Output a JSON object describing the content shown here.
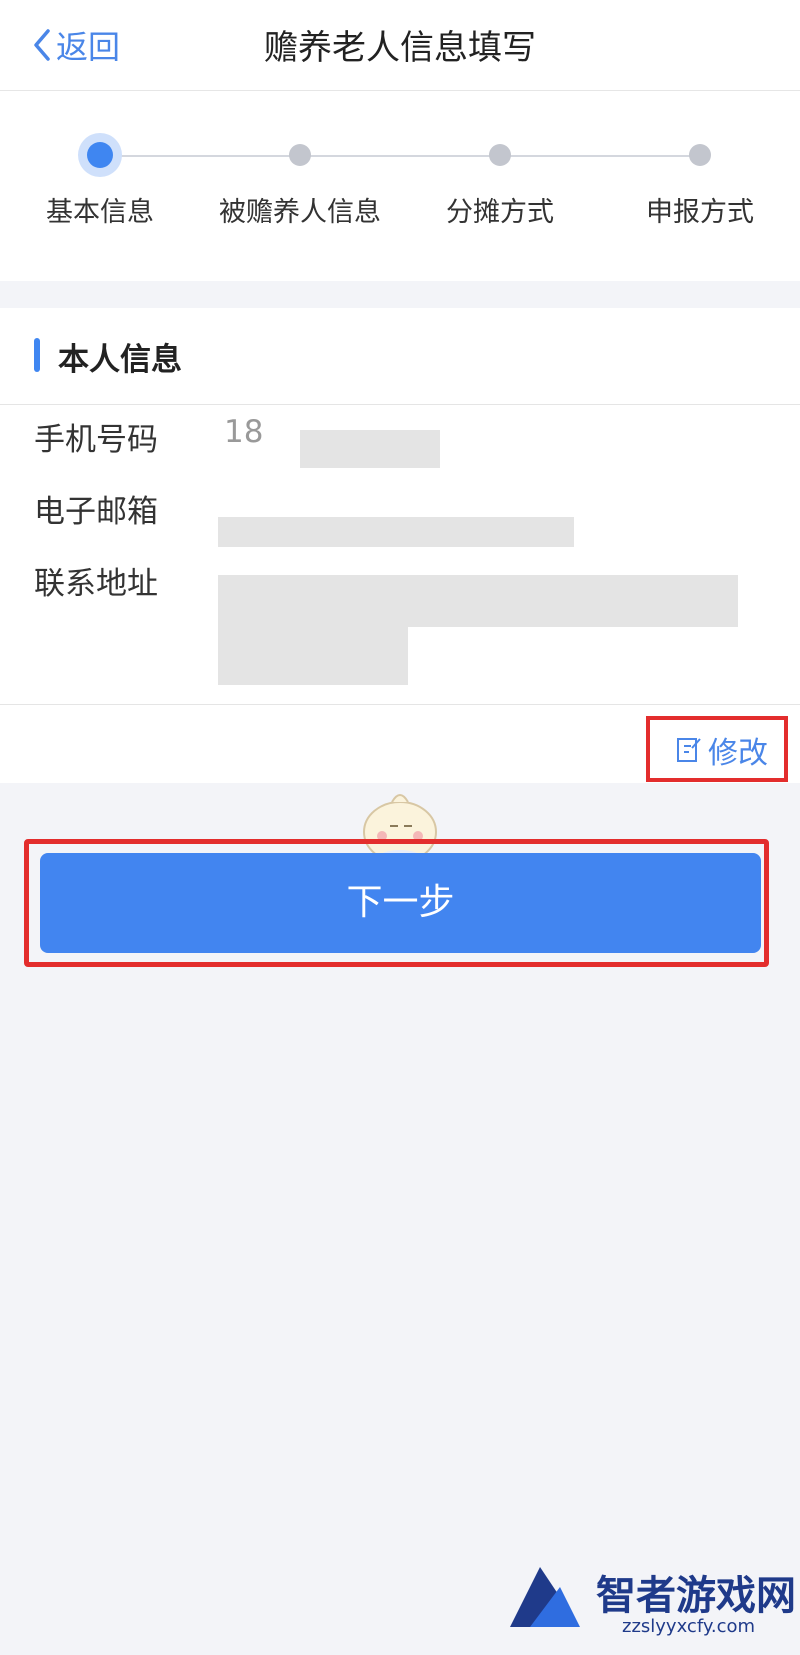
{
  "nav": {
    "back_label": "返回",
    "title": "赡养老人信息填写"
  },
  "steps": [
    {
      "label": "基本信息",
      "active": true
    },
    {
      "label": "被赡养人信息",
      "active": false
    },
    {
      "label": "分摊方式",
      "active": false
    },
    {
      "label": "申报方式",
      "active": false
    }
  ],
  "section": {
    "title": "本人信息",
    "rows": [
      {
        "label": "手机号码",
        "value": "18"
      },
      {
        "label": "电子邮箱",
        "value": ""
      },
      {
        "label": "联系地址",
        "value": ""
      }
    ],
    "edit_label": "修改"
  },
  "next_label": "下一步",
  "watermark": {
    "name": "智者游戏网",
    "site": "zzslyyxcfy.com"
  },
  "colors": {
    "accent": "#4285f0",
    "highlight": "#e32d2d"
  }
}
